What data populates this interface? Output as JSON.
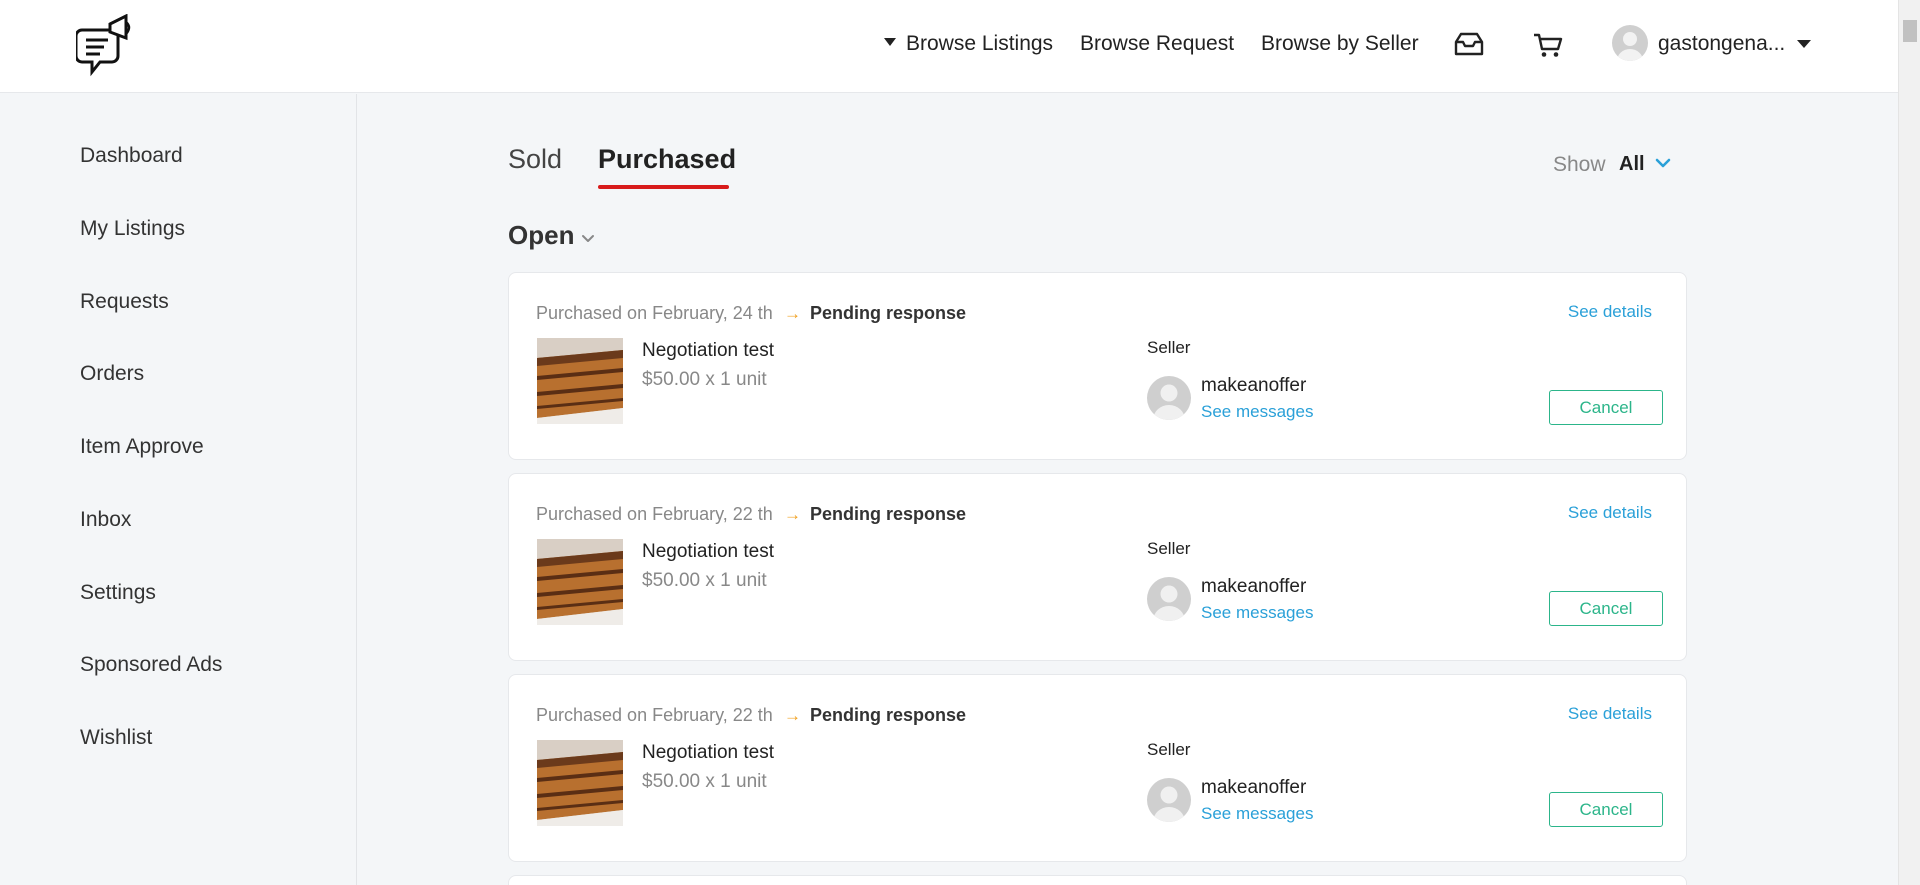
{
  "header": {
    "nav": {
      "browse_listings": "Browse Listings",
      "browse_request": "Browse Request",
      "browse_by_seller": "Browse by Seller"
    },
    "icons": [
      "inbox-tray-icon",
      "cart-icon"
    ],
    "username": "gastongena..."
  },
  "sidebar": {
    "items": [
      {
        "label": "Dashboard"
      },
      {
        "label": "My Listings"
      },
      {
        "label": "Requests"
      },
      {
        "label": "Orders"
      },
      {
        "label": "Item Approve"
      },
      {
        "label": "Inbox"
      },
      {
        "label": "Settings"
      },
      {
        "label": "Sponsored Ads"
      },
      {
        "label": "Wishlist"
      }
    ]
  },
  "main": {
    "tabs": [
      {
        "label": "Sold",
        "active": false
      },
      {
        "label": "Purchased",
        "active": true
      }
    ],
    "filter": {
      "label": "Show",
      "value": "All"
    },
    "section": {
      "title": "Open"
    },
    "orders": [
      {
        "date": "Purchased on February, 24 th",
        "status": "Pending response",
        "see_details": "See details",
        "title": "Negotiation test",
        "price": "$50.00 x 1 unit",
        "seller_label": "Seller",
        "seller_name": "makeanoffer",
        "see_messages": "See messages",
        "cancel": "Cancel"
      },
      {
        "date": "Purchased on February, 22 th",
        "status": "Pending response",
        "see_details": "See details",
        "title": "Negotiation test",
        "price": "$50.00 x 1 unit",
        "seller_label": "Seller",
        "seller_name": "makeanoffer",
        "see_messages": "See messages",
        "cancel": "Cancel"
      },
      {
        "date": "Purchased on February, 22 th",
        "status": "Pending response",
        "see_details": "See details",
        "title": "Negotiation test",
        "price": "$50.00 x 1 unit",
        "seller_label": "Seller",
        "seller_name": "makeanoffer",
        "see_messages": "See messages",
        "cancel": "Cancel"
      }
    ]
  },
  "colors": {
    "accent_blue": "#2aa0d8",
    "accent_green": "#2cb58a",
    "tab_underline": "#d81b1b",
    "arrow_orange": "#f0a020"
  }
}
